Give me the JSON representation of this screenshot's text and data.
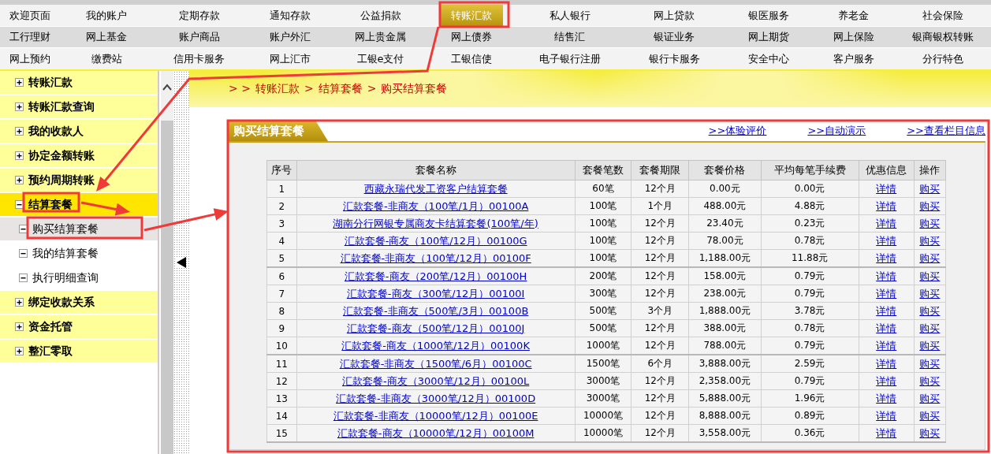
{
  "top_nav": {
    "rows": [
      [
        {
          "label": "欢迎页面",
          "selected": false
        },
        {
          "label": "我的账户",
          "selected": false
        },
        {
          "label": "定期存款",
          "selected": false
        },
        {
          "label": "通知存款",
          "selected": false
        },
        {
          "label": "公益捐款",
          "selected": false
        },
        {
          "label": "转账汇款",
          "selected": true
        },
        {
          "label": "私人银行",
          "selected": false
        },
        {
          "label": "网上贷款",
          "selected": false
        },
        {
          "label": "银医服务",
          "selected": false
        },
        {
          "label": "养老金",
          "selected": false
        },
        {
          "label": "社会保险",
          "selected": false
        }
      ],
      [
        {
          "label": "工行理财",
          "selected": false
        },
        {
          "label": "网上基金",
          "selected": false
        },
        {
          "label": "账户商品",
          "selected": false
        },
        {
          "label": "账户外汇",
          "selected": false
        },
        {
          "label": "网上贵金属",
          "selected": false
        },
        {
          "label": "网上债券",
          "selected": false
        },
        {
          "label": "结售汇",
          "selected": false
        },
        {
          "label": "银证业务",
          "selected": false
        },
        {
          "label": "网上期货",
          "selected": false
        },
        {
          "label": "网上保险",
          "selected": false
        },
        {
          "label": "银商银权转账",
          "selected": false
        }
      ],
      [
        {
          "label": "网上预约",
          "selected": false
        },
        {
          "label": "缴费站",
          "selected": false
        },
        {
          "label": "信用卡服务",
          "selected": false
        },
        {
          "label": "网上汇市",
          "selected": false
        },
        {
          "label": "工银e支付",
          "selected": false
        },
        {
          "label": "工银信使",
          "selected": false
        },
        {
          "label": "电子银行注册",
          "selected": false
        },
        {
          "label": "银行卡服务",
          "selected": false
        },
        {
          "label": "安全中心",
          "selected": false
        },
        {
          "label": "客户服务",
          "selected": false
        },
        {
          "label": "分行特色",
          "selected": false
        }
      ]
    ]
  },
  "sidebar": {
    "items": [
      {
        "label": "转账汇款",
        "expanded": false,
        "selected": false
      },
      {
        "label": "转账汇款查询",
        "expanded": false,
        "selected": false
      },
      {
        "label": "我的收款人",
        "expanded": false,
        "selected": false
      },
      {
        "label": "协定金额转账",
        "expanded": false,
        "selected": false
      },
      {
        "label": "预约周期转账",
        "expanded": false,
        "selected": false
      },
      {
        "label": "结算套餐",
        "expanded": true,
        "selected": true,
        "children": [
          {
            "label": "购买结算套餐",
            "selected": true
          },
          {
            "label": "我的结算套餐",
            "selected": false
          },
          {
            "label": "执行明细查询",
            "selected": false
          }
        ]
      },
      {
        "label": "绑定收款关系",
        "expanded": false,
        "selected": false
      },
      {
        "label": "资金托管",
        "expanded": false,
        "selected": false
      },
      {
        "label": "整汇零取",
        "expanded": false,
        "selected": false
      }
    ]
  },
  "breadcrumb": {
    "lead": "> >",
    "separator": ">",
    "items": [
      "转账汇款",
      "结算套餐",
      "购买结算套餐"
    ]
  },
  "panel": {
    "title": "购买结算套餐",
    "links": [
      ">>体验评价",
      ">>自动演示",
      ">>查看栏目信息"
    ],
    "table": {
      "columns": [
        {
          "label": "序号",
          "kind": "text"
        },
        {
          "label": "套餐名称",
          "kind": "link"
        },
        {
          "label": "套餐笔数",
          "kind": "text"
        },
        {
          "label": "套餐期限",
          "kind": "text"
        },
        {
          "label": "套餐价格",
          "kind": "text"
        },
        {
          "label": "平均每笔手续费",
          "kind": "text"
        },
        {
          "label": "优惠信息",
          "kind": "link"
        },
        {
          "label": "操作",
          "kind": "link"
        }
      ],
      "rows": [
        [
          "1",
          "西藏永瑞代发工资客户结算套餐",
          "60笔",
          "12个月",
          "0.00元",
          "0.00元",
          "详情",
          "购买"
        ],
        [
          "2",
          "汇款套餐-非商友（100笔/1月）00100A",
          "100笔",
          "1个月",
          "488.00元",
          "4.88元",
          "详情",
          "购买"
        ],
        [
          "3",
          "湖南分行网银专属商友卡结算套餐(100笔/年)",
          "100笔",
          "12个月",
          "23.40元",
          "0.23元",
          "详情",
          "购买"
        ],
        [
          "4",
          "汇款套餐-商友（100笔/12月）00100G",
          "100笔",
          "12个月",
          "78.00元",
          "0.78元",
          "详情",
          "购买"
        ],
        [
          "5",
          "汇款套餐-非商友（100笔/12月）00100F",
          "100笔",
          "12个月",
          "1,188.00元",
          "11.88元",
          "详情",
          "购买"
        ],
        [
          "6",
          "汇款套餐-商友（200笔/12月）00100H",
          "200笔",
          "12个月",
          "158.00元",
          "0.79元",
          "详情",
          "购买"
        ],
        [
          "7",
          "汇款套餐-商友（300笔/12月）00100I",
          "300笔",
          "12个月",
          "238.00元",
          "0.79元",
          "详情",
          "购买"
        ],
        [
          "8",
          "汇款套餐-非商友（500笔/3月）00100B",
          "500笔",
          "3个月",
          "1,888.00元",
          "3.78元",
          "详情",
          "购买"
        ],
        [
          "9",
          "汇款套餐-商友（500笔/12月）00100J",
          "500笔",
          "12个月",
          "388.00元",
          "0.78元",
          "详情",
          "购买"
        ],
        [
          "10",
          "汇款套餐-商友（1000笔/12月）00100K",
          "1000笔",
          "12个月",
          "788.00元",
          "0.79元",
          "详情",
          "购买"
        ],
        [
          "11",
          "汇款套餐-非商友（1500笔/6月）00100C",
          "1500笔",
          "6个月",
          "3,888.00元",
          "2.59元",
          "详情",
          "购买"
        ],
        [
          "12",
          "汇款套餐-商友（3000笔/12月）00100L",
          "3000笔",
          "12个月",
          "2,358.00元",
          "0.79元",
          "详情",
          "购买"
        ],
        [
          "13",
          "汇款套餐-非商友（3000笔/12月）00100D",
          "3000笔",
          "12个月",
          "5,888.00元",
          "1.96元",
          "详情",
          "购买"
        ],
        [
          "14",
          "汇款套餐-非商友（10000笔/12月）00100E",
          "10000笔",
          "12个月",
          "8,888.00元",
          "0.89元",
          "详情",
          "购买"
        ],
        [
          "15",
          "汇款套餐-商友（10000笔/12月）00100M",
          "10000笔",
          "12个月",
          "3,558.00元",
          "0.36元",
          "详情",
          "购买"
        ]
      ]
    }
  }
}
